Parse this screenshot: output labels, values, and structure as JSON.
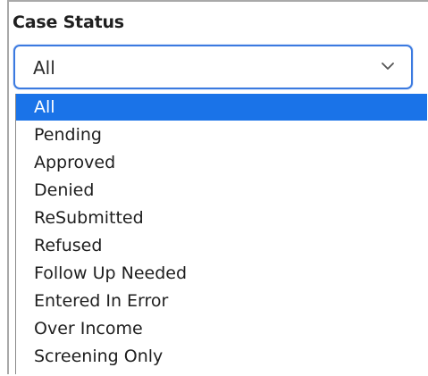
{
  "field": {
    "label": "Case Status",
    "selected_value": "All",
    "chevron_icon": "chevron-down-icon"
  },
  "dropdown": {
    "options": [
      {
        "label": "All",
        "selected": true
      },
      {
        "label": "Pending",
        "selected": false
      },
      {
        "label": "Approved",
        "selected": false
      },
      {
        "label": "Denied",
        "selected": false
      },
      {
        "label": "ReSubmitted",
        "selected": false
      },
      {
        "label": "Refused",
        "selected": false
      },
      {
        "label": "Follow Up Needed",
        "selected": false
      },
      {
        "label": "Entered In Error",
        "selected": false
      },
      {
        "label": "Over Income",
        "selected": false
      },
      {
        "label": "Screening Only",
        "selected": false
      }
    ]
  },
  "colors": {
    "focus_border": "#3b7ae0",
    "selected_option_bg": "#1a73e8",
    "selected_option_text": "#ffffff"
  }
}
